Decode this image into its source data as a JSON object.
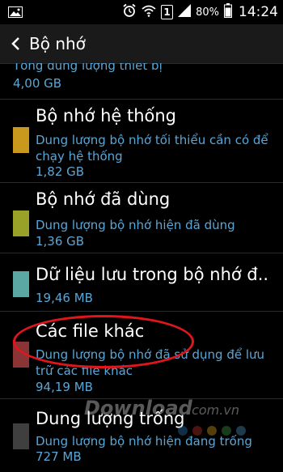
{
  "status_bar": {
    "battery": "80%",
    "time": "14:24",
    "sim_badge": "1"
  },
  "action_bar": {
    "title": "Bộ nhớ"
  },
  "partial_item": {
    "desc": "Tổng dung lượng thiết bị",
    "size": "4,00 GB"
  },
  "items": [
    {
      "title": "Bộ nhớ hệ thống",
      "desc": "Dung lượng bộ nhớ tối thiểu cần có để chạy hệ thống",
      "size": "1,82 GB",
      "color": "#c9991d"
    },
    {
      "title": "Bộ nhớ đã dùng",
      "desc": "Dung lượng bộ nhớ hiện đã dùng",
      "size": "1,36 GB",
      "color": "#9aa128"
    },
    {
      "title": "Dữ liệu lưu trong bộ nhớ đ..",
      "desc": "",
      "size": "19,46 MB",
      "color": "#5aa7a4"
    },
    {
      "title": "Các file khác",
      "desc": "Dung lượng bộ nhớ đã sử dụng để lưu trữ các file khác",
      "size": "94,19 MB",
      "color": "#8a3436"
    },
    {
      "title": "Dung lượng trống",
      "desc": "Dung lượng bộ nhớ hiện đang trống",
      "size": "727 MB",
      "color": "#3f3f3f"
    }
  ],
  "watermark": {
    "text": "Download",
    "suffix": ".com.vn"
  }
}
